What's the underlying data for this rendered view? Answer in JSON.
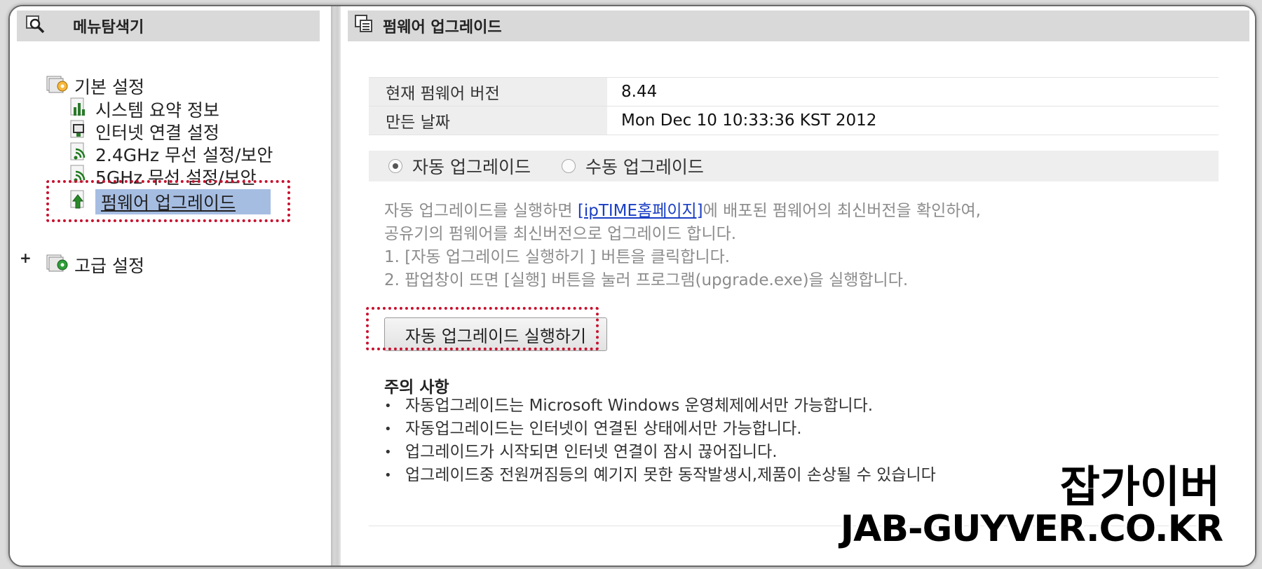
{
  "left_panel": {
    "title": "메뉴탐색기",
    "basic_folder": "기본 설정",
    "items": [
      {
        "label": "시스템 요약 정보",
        "icon": "chart-icon"
      },
      {
        "label": "인터넷 연결 설정",
        "icon": "monitor-icon"
      },
      {
        "label": "2.4GHz 무선 설정/보안",
        "icon": "wireless-icon"
      },
      {
        "label": "5GHz 무선 설정/보안",
        "icon": "wireless-icon"
      },
      {
        "label": "펌웨어 업그레이드",
        "icon": "upgrade-icon",
        "selected": true
      }
    ],
    "advanced_expander": "+",
    "advanced_folder": "고급 설정"
  },
  "right_panel": {
    "title": "펌웨어 업그레이드",
    "info": [
      {
        "label": "현재 펌웨어 버전",
        "value": "8.44"
      },
      {
        "label": "만든 날짜",
        "value": "Mon Dec 10 10:33:36 KST 2012"
      }
    ],
    "radio": {
      "auto_label": "자동 업그레이드",
      "manual_label": "수동 업그레이드",
      "selected": "auto"
    },
    "description": {
      "line1_pre": "자동 업그레이드를 실행하면 ",
      "line1_link": "[ipTIME홈페이지]",
      "line1_post": "에 배포된 펌웨어의 최신버전을 확인하여,",
      "line2": "공유기의 펌웨어를 최신버전으로 업그레이드 합니다.",
      "line3": "1. [자동 업그레이드 실행하기 ] 버튼을 클릭합니다.",
      "line4": "2. 팝업창이 뜨면 [실행] 버튼을 눌러 프로그램(upgrade.exe)을 실행합니다."
    },
    "run_button": "자동 업그레이드 실행하기",
    "notes_title": "주의 사항",
    "notes": [
      "자동업그레이드는 Microsoft Windows 운영체제에서만 가능합니다.",
      "자동업그레이드는 인터넷이 연결된 상태에서만 가능합니다.",
      "업그레이드가 시작되면 인터넷 연결이 잠시 끊어집니다.",
      "업그레이드중 전원꺼짐등의 예기지 못한 동작발생시,제품이 손상될 수 있습니다"
    ]
  },
  "watermark": {
    "line1": "잡가이버",
    "line2": "JAB-GUYVER.CO.KR"
  },
  "colors": {
    "highlight": "#c8102e",
    "selection": "#a6bde2",
    "link": "#1a3ec4",
    "header_bg": "#d9d9d9"
  }
}
